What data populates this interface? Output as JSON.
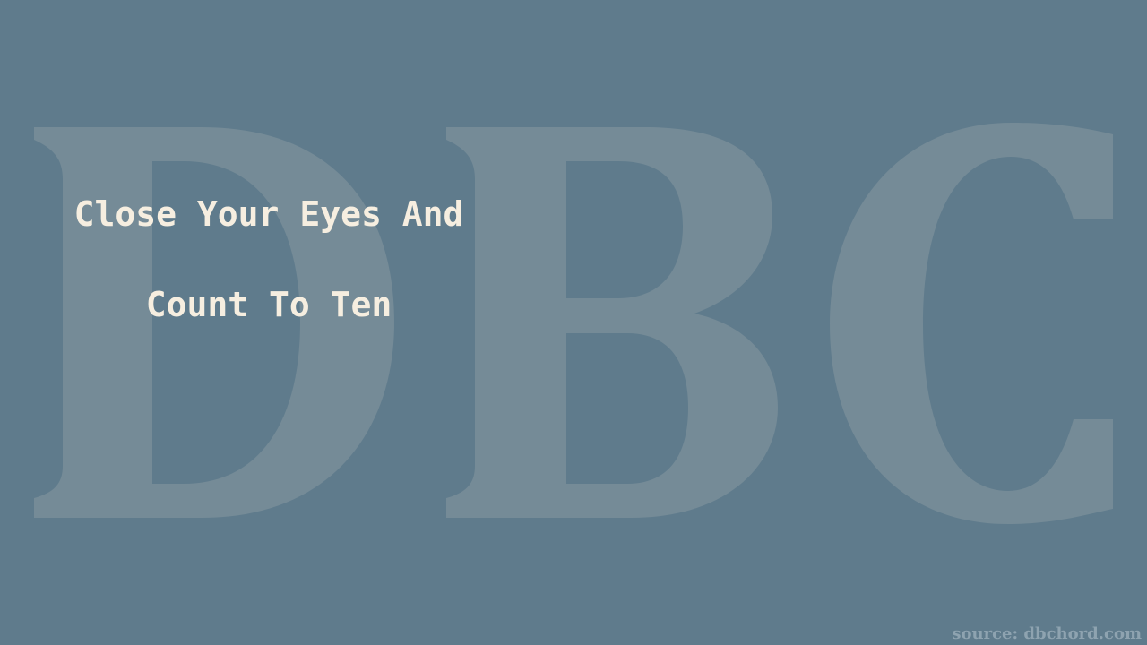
{
  "song": {
    "title_line_1": "Close Your Eyes And",
    "title_line_2": "Count To Ten"
  },
  "watermark": {
    "text": "DBC"
  },
  "footer": {
    "source": "source: dbchord.com"
  },
  "colors": {
    "background": "#5f7b8c",
    "title_text": "#f6eee0",
    "watermark": "#758b97",
    "source_text": "#8ea3b0"
  }
}
